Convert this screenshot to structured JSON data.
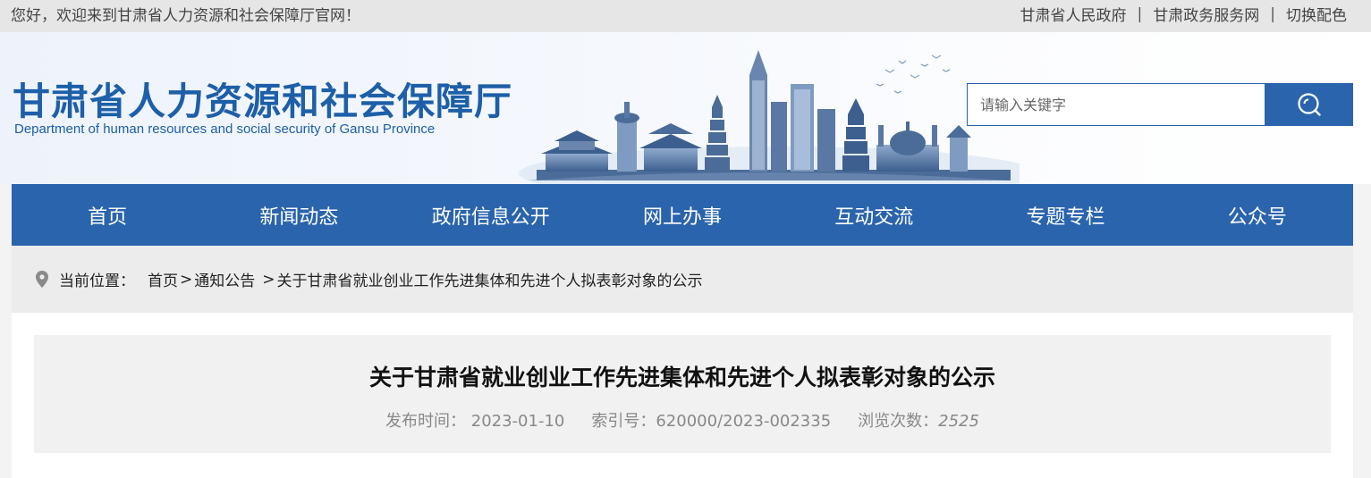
{
  "topbar": {
    "welcome": "您好，欢迎来到甘肃省人力资源和社会保障厅官网！",
    "links": [
      "甘肃省人民政府",
      "甘肃政务服务网",
      "切换配色"
    ],
    "separator": "|"
  },
  "header": {
    "title_cn": "甘肃省人力资源和社会保障厅",
    "title_en": "Department of human resources and social security of Gansu Province"
  },
  "search": {
    "placeholder": "请输入关键字",
    "icon": "search-icon"
  },
  "nav": {
    "items": [
      "首页",
      "新闻动态",
      "政府信息公开",
      "网上办事",
      "互动交流",
      "专题专栏",
      "公众号"
    ]
  },
  "breadcrumb": {
    "label": "当前位置：",
    "items": [
      "首页",
      "通知公告",
      "关于甘肃省就业创业工作先进集体和先进个人拟表彰对象的公示"
    ],
    "sep": ">",
    "icon": "location-pin-icon"
  },
  "article": {
    "title": "关于甘肃省就业创业工作先进集体和先进个人拟表彰对象的公示",
    "publish_label": "发布时间：",
    "publish_date": "2023-01-10",
    "index_label": "索引号：",
    "index_no": "620000/2023-002335",
    "views_label": "浏览次数：",
    "views": "2525"
  },
  "colors": {
    "primary": "#2a64ad",
    "brand_text": "#1d5fa8",
    "topbar_bg": "#e6e6e6"
  }
}
